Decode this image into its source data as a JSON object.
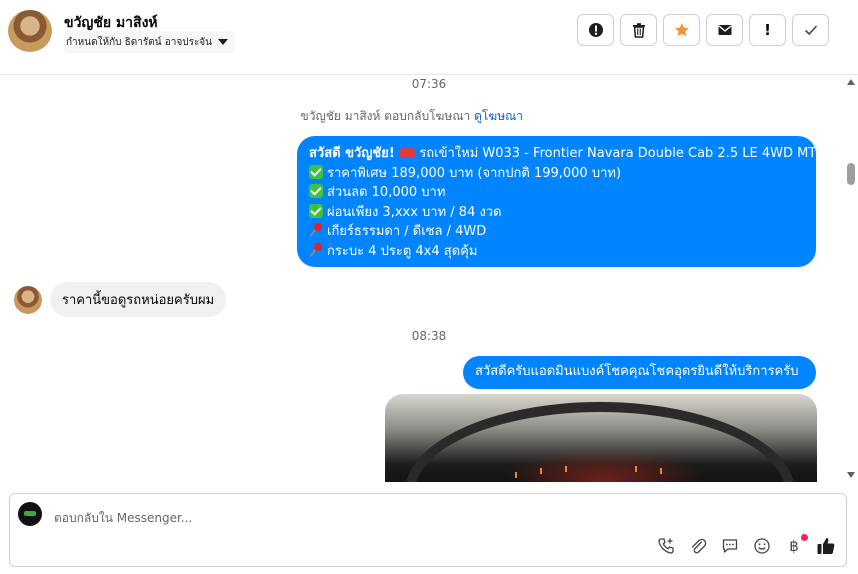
{
  "header": {
    "contact_name": "ขวัญชัย มาสิงห์",
    "assigned_label": "กำหนดให้กับ ธิดารัตน์ อาจประจัน",
    "actions": [
      {
        "name": "spam-icon"
      },
      {
        "name": "trash-icon"
      },
      {
        "name": "star-icon",
        "color": "#f7923a"
      },
      {
        "name": "mail-icon"
      },
      {
        "name": "alert-icon",
        "text": "!"
      },
      {
        "name": "check-icon"
      }
    ]
  },
  "chat": {
    "time_1": "07:36",
    "reply_note_prefix": "ขวัญชัย มาสิงห์ ตอบกลับโฆษณา",
    "reply_note_link": "ดูโฆษณา",
    "ad_message": {
      "title": "สวัสดี ขวัญชัย!",
      "title_rest": "รถเข้าใหม่ W033 - Frontier Navara Double Cab 2.5 LE 4WD MT",
      "line_1": "ราคาพิเศษ 189,000 บาท (จากปกติ 199,000 บาท)",
      "line_2": "ส่วนลด 10,000 บาท",
      "line_3": "ผ่อนเพียง 3,xxx บาท / 84 งวด",
      "line_4": "เกียร์ธรรมดา / ดีเซล / 4WD",
      "line_5": "กระบะ 4 ประตู 4x4 สุดคุ้ม"
    },
    "incoming_message": "ราคานี้ขอดูรถหน่อยครับผม",
    "time_2": "08:38",
    "outgoing_message": "สวัสดีครับแอดมินแบงค์โชคคุณโชคอุดรยินดีให้บริการครับ"
  },
  "composer": {
    "placeholder": "ตอบกลับใน Messenger...",
    "tools": [
      "phone-add-icon",
      "attachment-icon",
      "saved-reply-icon",
      "emoji-icon",
      "baht-icon",
      "like-icon"
    ]
  },
  "colors": {
    "outgoing_bubble": "#0084ff",
    "incoming_bubble": "#f0f0f0",
    "link": "#0064d1"
  }
}
